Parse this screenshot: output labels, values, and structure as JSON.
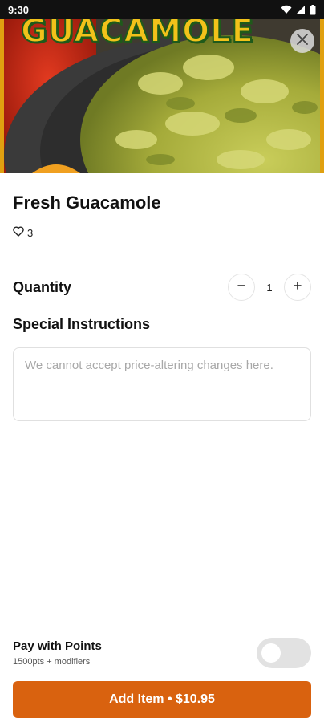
{
  "status_bar": {
    "time": "9:30"
  },
  "hero": {
    "title": "GUACAMOLE"
  },
  "item": {
    "title": "Fresh Guacamole",
    "likes": "3"
  },
  "quantity": {
    "label": "Quantity",
    "value": "1"
  },
  "instructions": {
    "label": "Special Instructions",
    "placeholder": "We cannot accept price-altering changes here."
  },
  "points": {
    "title": "Pay with Points",
    "subtitle": "1500pts + modifiers",
    "enabled": false
  },
  "cta": {
    "label": "Add Item • $10.95"
  },
  "colors": {
    "accent": "#d9620f",
    "toggle_off": "#e2e2e2"
  }
}
